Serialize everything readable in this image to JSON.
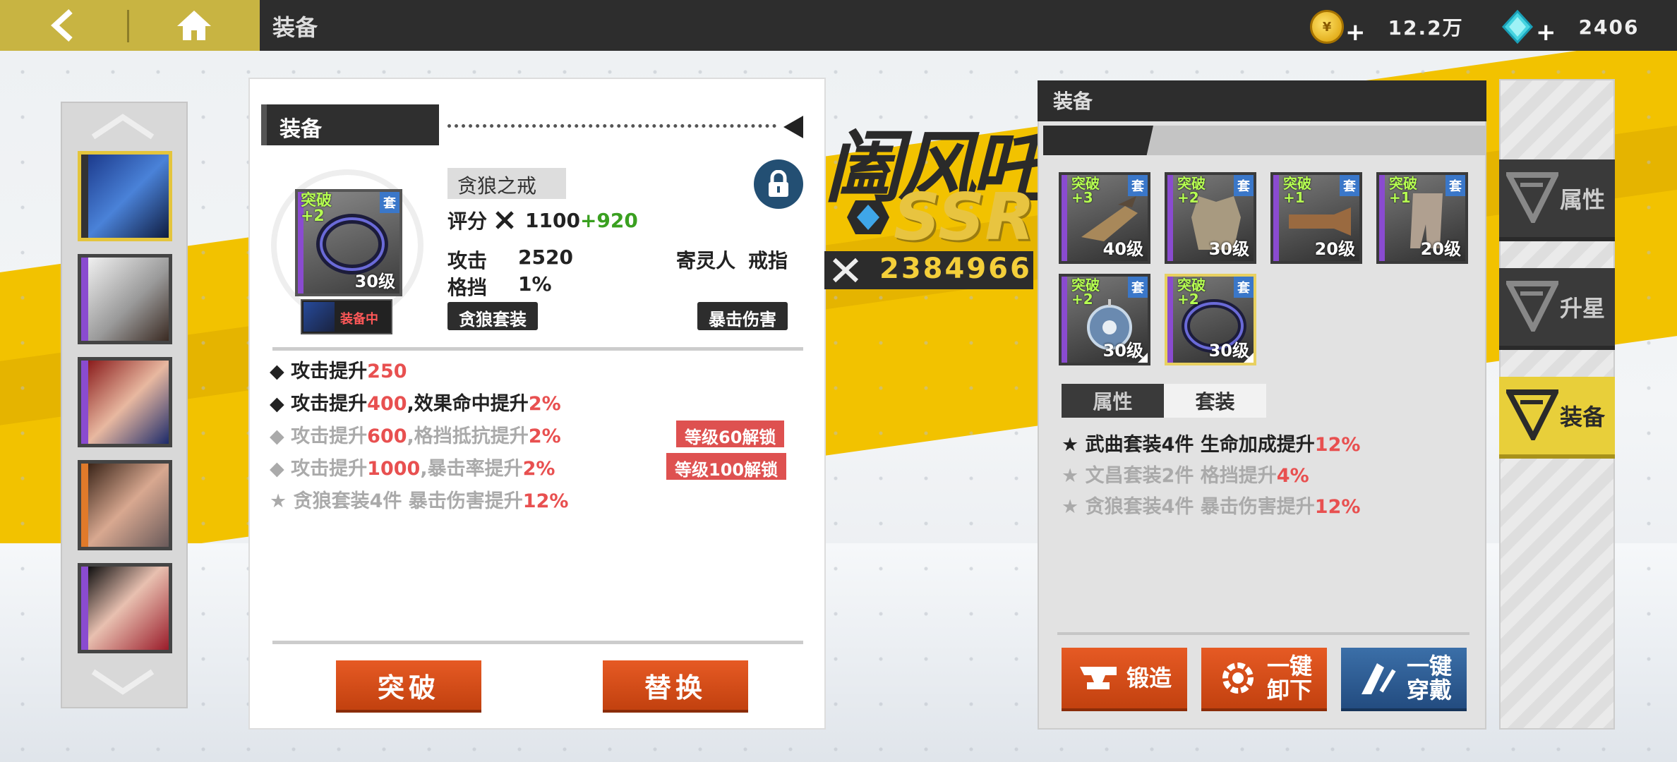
{
  "topbar": {
    "title": "装备",
    "gold": "12.2万",
    "gold_icon": "gold-coin-icon",
    "gem": "2406",
    "gem_icon": "diamond-icon",
    "plus": "+"
  },
  "colors": {
    "accent": "#e8cf3a",
    "orange_button": "#d4501a",
    "blue_button": "#2e5d94",
    "red_value": "#e85050",
    "green_bonus": "#3aa020",
    "dark_panel": "#2d2d2d"
  },
  "detail": {
    "header": "装备",
    "item_name": "贪狼之戒",
    "break_tag": "突破\n+2",
    "set_tag": "套",
    "level": "30级",
    "equipped_label": "装备中",
    "score_label": "评分",
    "score_base": "1100",
    "score_bonus": "+920",
    "atk_label": "攻击",
    "atk_value": "2520",
    "block_label": "格挡",
    "block_value": "1%",
    "owner_label": "寄灵人",
    "slot_type": "戒指",
    "set_chip": "贪狼套装",
    "effect_chip": "暴击伤害",
    "bonuses": [
      {
        "parts": [
          "攻击提升",
          "250"
        ],
        "active": true
      },
      {
        "parts": [
          "攻击提升",
          "400",
          ",效果命中提升",
          "2%"
        ],
        "active": true
      },
      {
        "parts": [
          "攻击提升",
          "600",
          ",格挡抵抗提升",
          "2%"
        ],
        "active": false,
        "unlock": "等级60解锁"
      },
      {
        "parts": [
          "攻击提升",
          "1000",
          ",暴击率提升",
          "2%"
        ],
        "active": false,
        "unlock": "等级100解锁"
      },
      {
        "parts": [
          "贪狼套装4件  暴击伤害提升",
          "12%"
        ],
        "active": false,
        "star": true
      }
    ],
    "btn_break": "突破",
    "btn_replace": "替换"
  },
  "banner": {
    "name": "阖风吒",
    "rarity": "SSR",
    "power": "2384966"
  },
  "equip_panel": {
    "title": "装备",
    "slots": [
      {
        "break": "突破\n+3",
        "set": "套",
        "level": "40级",
        "icon": "claw-weapon-icon"
      },
      {
        "break": "突破\n+2",
        "set": "套",
        "level": "30级",
        "icon": "armor-icon"
      },
      {
        "break": "突破\n+1",
        "set": "套",
        "level": "20级",
        "icon": "gauntlet-icon"
      },
      {
        "break": "突破\n+1",
        "set": "套",
        "level": "20级",
        "icon": "boots-icon"
      },
      {
        "break": "突破\n+2",
        "set": "套",
        "level": "30级",
        "icon": "amulet-icon"
      },
      {
        "break": "突破\n+2",
        "set": "套",
        "level": "30级",
        "icon": "ring-icon"
      }
    ],
    "tab_attr": "属性",
    "tab_set": "套装",
    "set_lines": [
      {
        "parts": [
          "武曲套装4件  生命加成提升",
          "12%"
        ],
        "active": true
      },
      {
        "parts": [
          "文昌套装2件  格挡提升",
          "4%"
        ],
        "active": false
      },
      {
        "parts": [
          "贪狼套装4件  暴击伤害提升",
          "12%"
        ],
        "active": false
      }
    ],
    "btn_forge": "锻造",
    "btn_unequip": "一键\n卸下",
    "btn_equip": "一键\n穿戴"
  },
  "side_tabs": [
    "属性",
    "升星",
    "装备"
  ]
}
